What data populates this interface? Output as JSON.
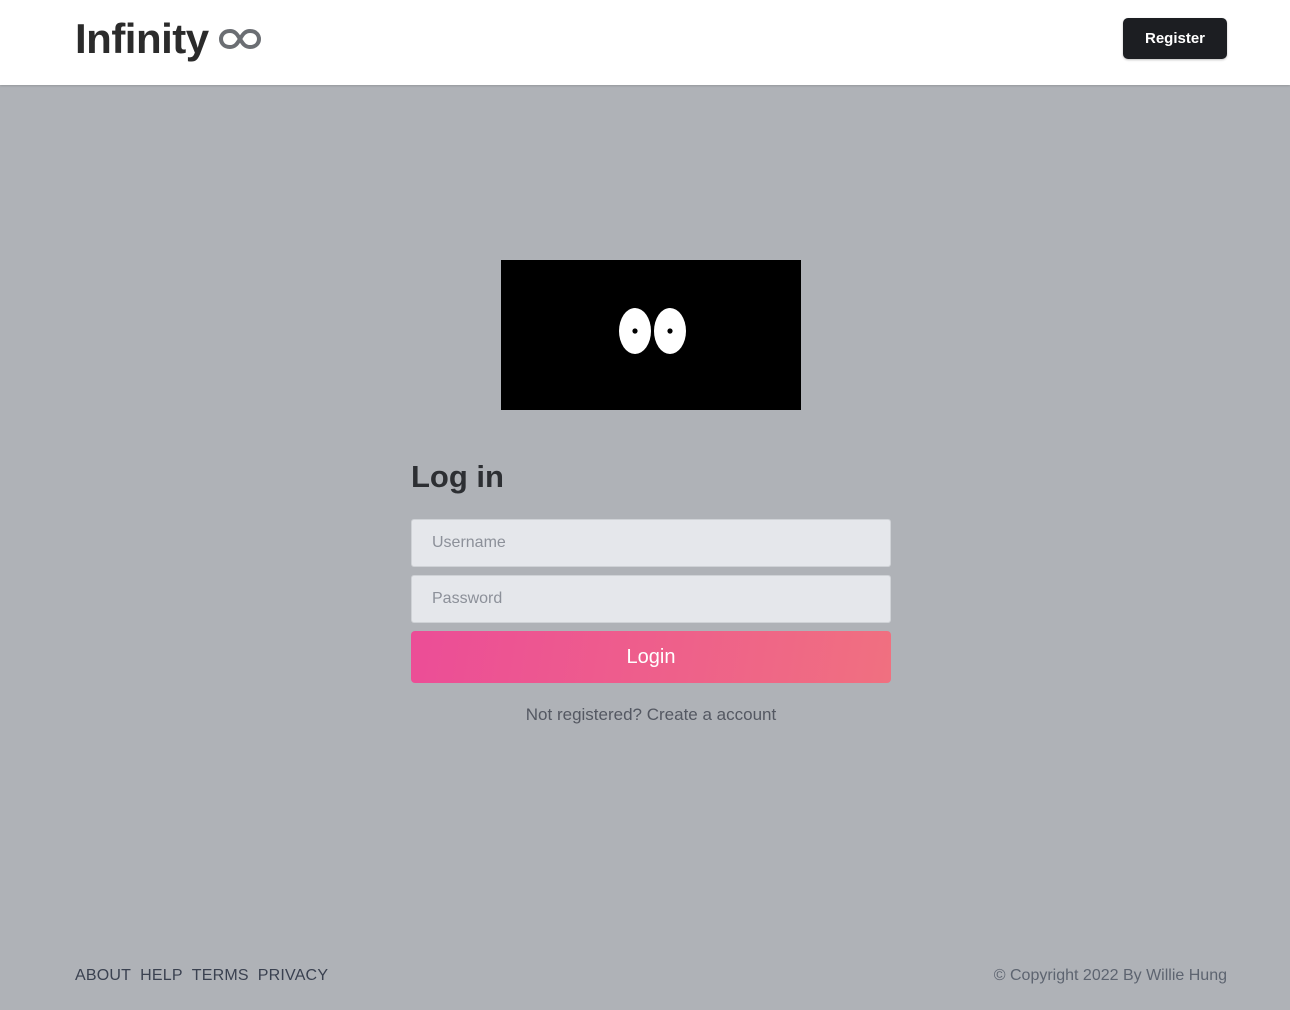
{
  "header": {
    "brand": "Infinity",
    "brand_icon": "infinity-icon",
    "register_label": "Register"
  },
  "hero": {
    "icon": "eyes-icon",
    "background": "#000000"
  },
  "login": {
    "title": "Log in",
    "username_placeholder": "Username",
    "username_value": "",
    "password_placeholder": "Password",
    "password_value": "",
    "submit_label": "Login",
    "signup_text": "Not registered? Create a account"
  },
  "footer": {
    "links": [
      "ABOUT",
      "HELP",
      "TERMS",
      "PRIVACY"
    ],
    "copyright": "© Copyright 2022 By Willie Hung"
  },
  "colors": {
    "page_background": "#afb2b7",
    "header_background": "#ffffff",
    "register_button": "#1c1e22",
    "login_gradient_start": "#ec4d97",
    "login_gradient_end": "#f07080"
  }
}
